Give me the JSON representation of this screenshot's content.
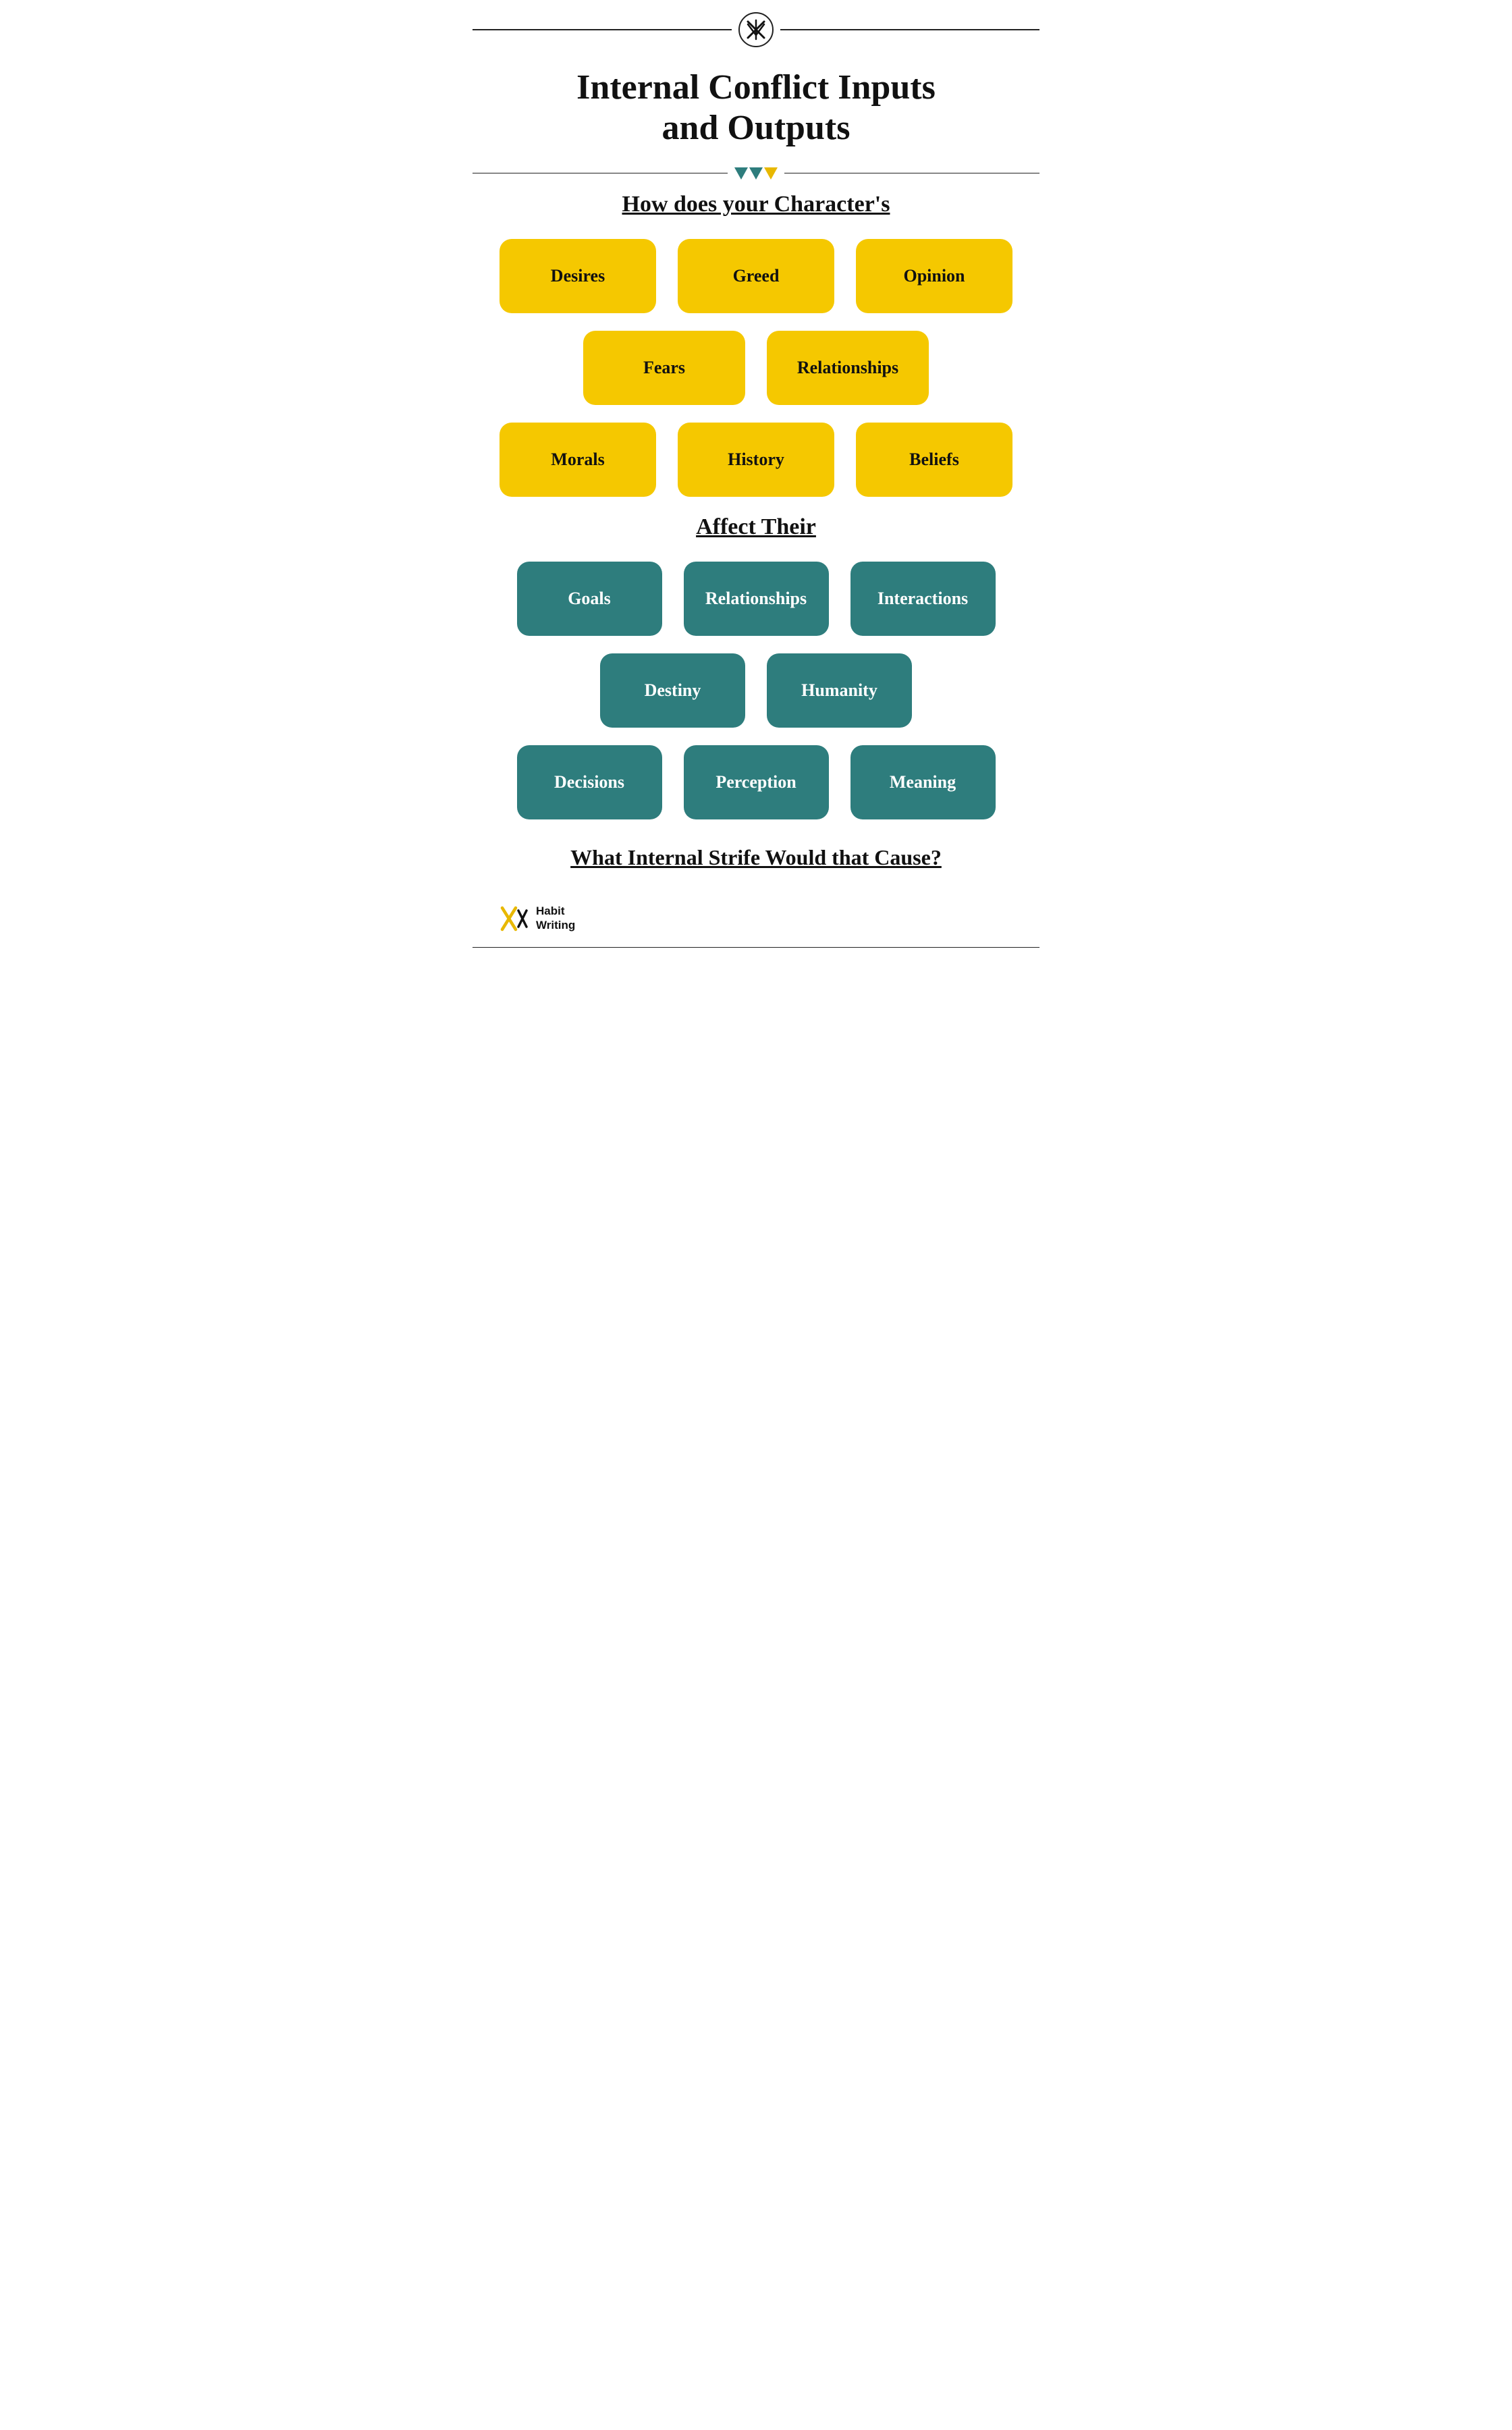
{
  "header": {
    "logo_text": "HW"
  },
  "title": {
    "line1": "Internal Conflict Inputs",
    "line2": "and Outputs"
  },
  "section1": {
    "heading": "How does your Character's"
  },
  "inputs": {
    "row1": [
      {
        "label": "Desires"
      },
      {
        "label": "Greed"
      },
      {
        "label": "Opinion"
      }
    ],
    "row2": [
      {
        "label": "Fears"
      },
      {
        "label": "Relationships"
      }
    ],
    "row3": [
      {
        "label": "Morals"
      },
      {
        "label": "History"
      },
      {
        "label": "Beliefs"
      }
    ]
  },
  "section2": {
    "heading": "Affect Their"
  },
  "outputs": {
    "row1": [
      {
        "label": "Goals"
      },
      {
        "label": "Relationships"
      },
      {
        "label": "Interactions"
      }
    ],
    "row2": [
      {
        "label": "Destiny"
      },
      {
        "label": "Humanity"
      }
    ],
    "row3": [
      {
        "label": "Decisions"
      },
      {
        "label": "Perception"
      },
      {
        "label": "Meaning"
      }
    ]
  },
  "section3": {
    "heading": "What Internal Strife Would that Cause?"
  },
  "brand": {
    "name_line1": "Habit",
    "name_line2": "Writing"
  }
}
